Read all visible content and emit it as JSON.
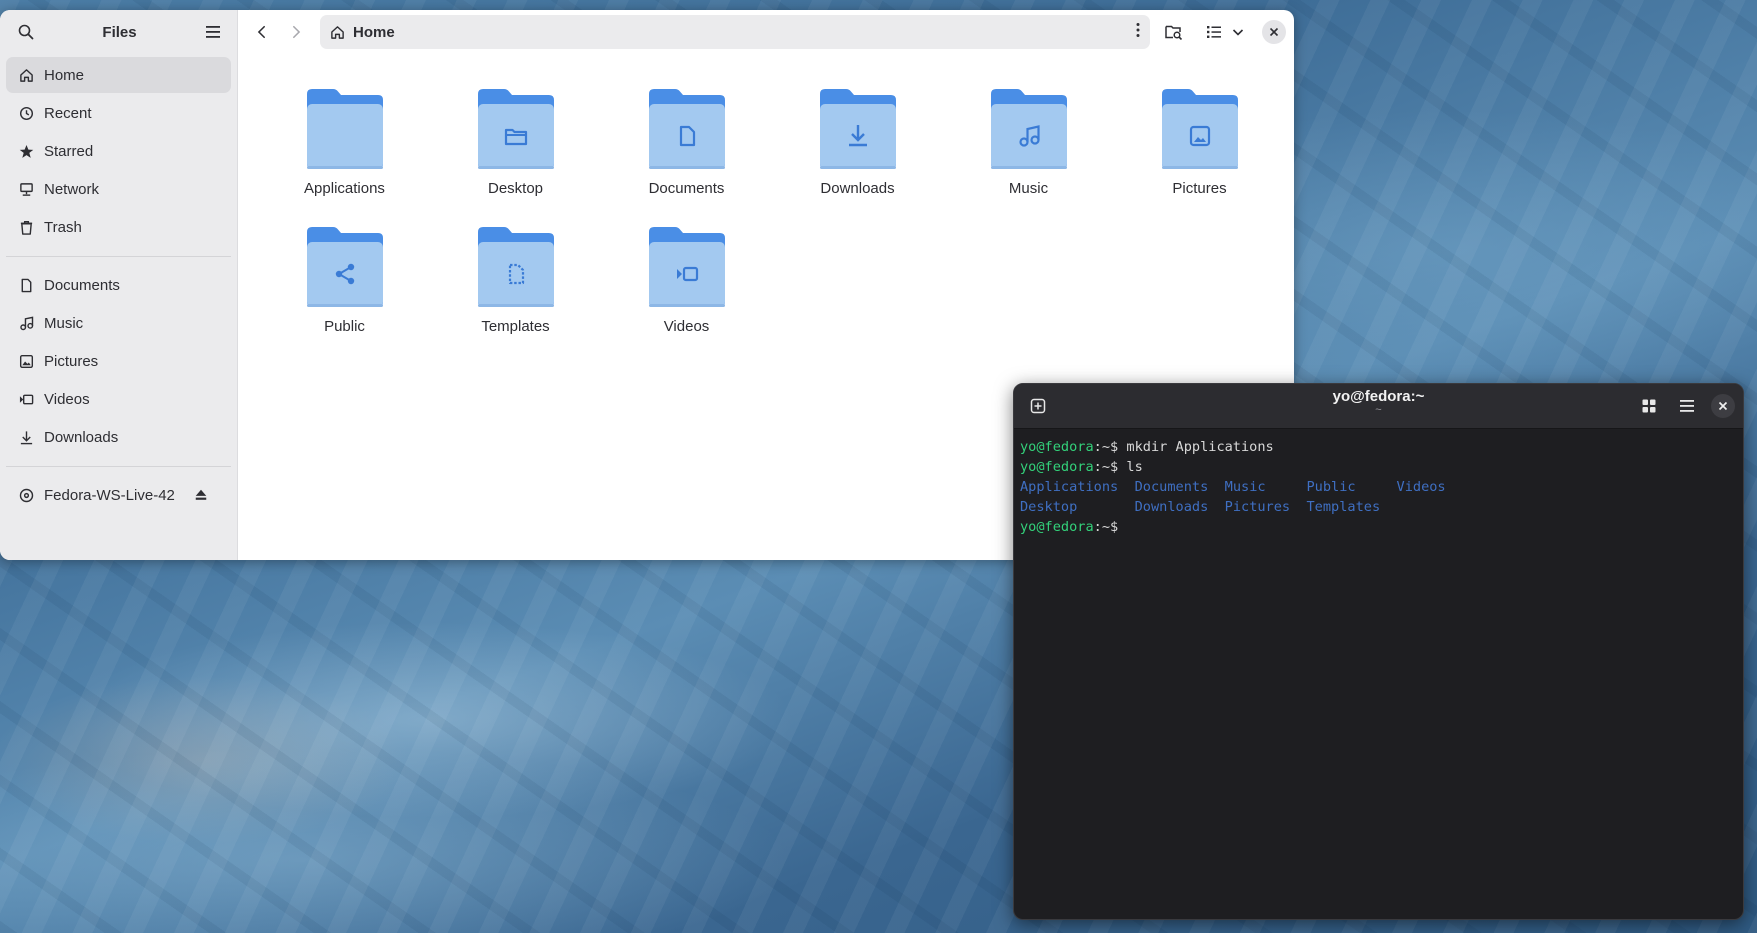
{
  "files": {
    "sidebar_title": "Files",
    "places": [
      {
        "label": "Home",
        "icon": "home-icon",
        "active": true
      },
      {
        "label": "Recent",
        "icon": "clock-icon"
      },
      {
        "label": "Starred",
        "icon": "star-icon"
      },
      {
        "label": "Network",
        "icon": "network-icon"
      },
      {
        "label": "Trash",
        "icon": "trash-icon"
      }
    ],
    "bookmarks": [
      {
        "label": "Documents",
        "icon": "document-icon"
      },
      {
        "label": "Music",
        "icon": "music-icon"
      },
      {
        "label": "Pictures",
        "icon": "picture-icon"
      },
      {
        "label": "Videos",
        "icon": "video-icon"
      },
      {
        "label": "Downloads",
        "icon": "download-icon"
      }
    ],
    "devices": [
      {
        "label": "Fedora-WS-Live-42",
        "icon": "disc-icon"
      }
    ],
    "path": "Home",
    "folders": [
      {
        "label": "Applications",
        "emblem": "none"
      },
      {
        "label": "Desktop",
        "emblem": "folder"
      },
      {
        "label": "Documents",
        "emblem": "document"
      },
      {
        "label": "Downloads",
        "emblem": "download"
      },
      {
        "label": "Music",
        "emblem": "music"
      },
      {
        "label": "Pictures",
        "emblem": "picture"
      },
      {
        "label": "Public",
        "emblem": "share"
      },
      {
        "label": "Templates",
        "emblem": "template"
      },
      {
        "label": "Videos",
        "emblem": "video"
      }
    ]
  },
  "terminal": {
    "title": "yo@fedora:~",
    "subtitle": "~",
    "prompt_user": "yo@fedora",
    "prompt_rest": ":~$",
    "lines": [
      {
        "cmd": " mkdir Applications"
      },
      {
        "cmd": " ls"
      }
    ],
    "ls_row1": [
      "Applications",
      "Documents",
      "Music",
      "Public",
      "Videos"
    ],
    "ls_row2": [
      "Desktop",
      "Downloads",
      "Pictures",
      "Templates"
    ]
  },
  "colors": {
    "folder_back": "#4a8ee6",
    "folder_front": "#a3c9f0",
    "emblem": "#3a7bd5",
    "prompt_green": "#33d17a",
    "dir_blue": "#3f6fc2"
  }
}
